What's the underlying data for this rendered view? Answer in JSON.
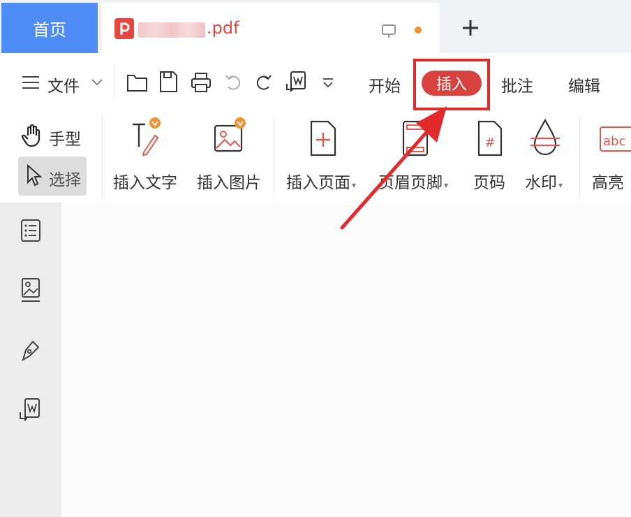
{
  "tabs": {
    "home": "首页",
    "file_ext": ".pdf"
  },
  "menu": {
    "file": "文件",
    "start": "开始",
    "insert": "插入",
    "annotate": "批注",
    "edit": "编辑"
  },
  "ribbon": {
    "hand": "手型",
    "select": "选择",
    "insert_text": "插入文字",
    "insert_image": "插入图片",
    "insert_page": "插入页面",
    "header_footer": "页眉页脚",
    "page_number": "页码",
    "watermark": "水印",
    "highlight": "高亮"
  },
  "colors": {
    "accent_blue": "#4d8df5",
    "accent_red": "#d9413f",
    "annotation_red": "#e12b2b"
  }
}
